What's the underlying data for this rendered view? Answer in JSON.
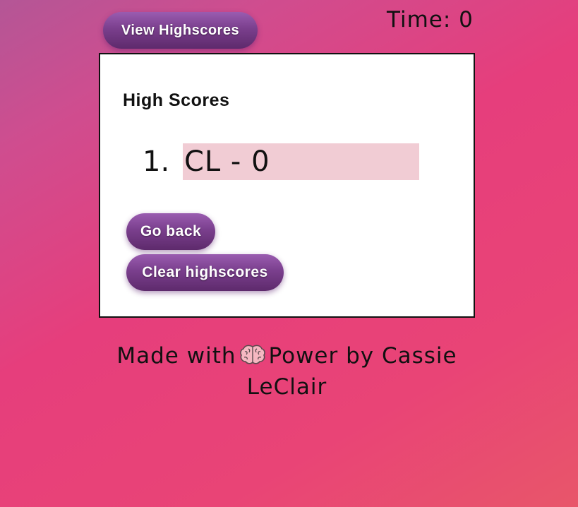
{
  "header": {
    "view_highscores_label": "View Highscores",
    "timer_text": "Time: 0"
  },
  "highscores": {
    "title": "High Scores",
    "entries": [
      {
        "rank": "1.",
        "text": "CL - 0"
      }
    ],
    "go_back_label": "Go back",
    "clear_label": "Clear highscores"
  },
  "footer": {
    "prefix": "Made with",
    "icon": "brain-icon",
    "suffix": "Power by Cassie LeClair"
  },
  "colors": {
    "button_gradient_top": "#9a5cb0",
    "button_gradient_bottom": "#5e2a6c",
    "score_highlight": "#f1ccd4",
    "background_primary": "#e63e7c"
  }
}
